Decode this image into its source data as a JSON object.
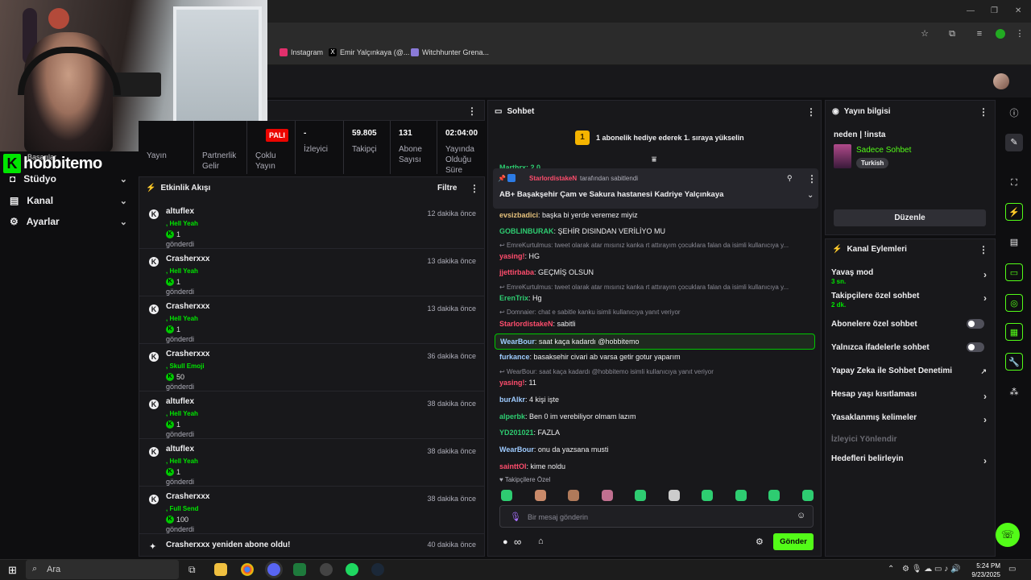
{
  "browser": {
    "bookmarks": [
      {
        "label": "Instagram",
        "icon": "instagram-icon",
        "color": "#e1306c"
      },
      {
        "label": "Emir Yalçınkaya (@...",
        "icon": "x-icon",
        "color": "#ffffff"
      },
      {
        "label": "Witchhunter Grena...",
        "icon": "game-icon",
        "color": "#8a7ad8"
      }
    ]
  },
  "nav": {
    "brand": "hobbitemo",
    "brand_letter": "K",
    "achievements": "Başarılar",
    "items": [
      {
        "label": "Stüdyo",
        "icon": "studio-icon"
      },
      {
        "label": "Kanal",
        "icon": "channel-icon"
      },
      {
        "label": "Ayarlar",
        "icon": "gear-icon"
      }
    ]
  },
  "stats": {
    "live_badge": "PALI",
    "viewers_value": "-",
    "viewers_label": "İzleyici",
    "followers_value": "59.805",
    "followers_label": "Takipçi",
    "subs_value": "131",
    "subs_label": "Abone Sayısı",
    "uptime_value": "02:04:00",
    "uptime_label": "Yayında Olduğu Süre",
    "stream_label": "Yayın",
    "partner_label": "Partnerlik Gelir",
    "multi_label": "Çoklu Yayın"
  },
  "activity": {
    "title": "Etkinlik Akışı",
    "filter": "Filtre",
    "events": [
      {
        "user": "altuflex",
        "item": "Hell Yeah",
        "count": "1",
        "sent": "gönderdi",
        "time": "12 dakika önce"
      },
      {
        "user": "Crasherxxx",
        "item": "Hell Yeah",
        "count": "1",
        "sent": "gönderdi",
        "time": "13 dakika önce"
      },
      {
        "user": "Crasherxxx",
        "item": "Hell Yeah",
        "count": "1",
        "sent": "gönderdi",
        "time": "13 dakika önce"
      },
      {
        "user": "Crasherxxx",
        "item": "Skull Emoji",
        "count": "50",
        "sent": "gönderdi",
        "time": "36 dakika önce"
      },
      {
        "user": "altuflex",
        "item": "Hell Yeah",
        "count": "1",
        "sent": "gönderdi",
        "time": "38 dakika önce"
      },
      {
        "user": "altuflex",
        "item": "Hell Yeah",
        "count": "1",
        "sent": "gönderdi",
        "time": "38 dakika önce"
      },
      {
        "user": "Crasherxxx",
        "item": "Full Send",
        "count": "100",
        "sent": "gönderdi",
        "time": "38 dakika önce"
      }
    ],
    "last_event": "Crasherxxx yeniden abone oldu!",
    "last_time": "40 dakika önce",
    "item_prefix": ","
  },
  "chat": {
    "title": "Sohbet",
    "gift_rank": "1",
    "gift_text": "1 abonelik hediye ederek 1. sıraya yükselin",
    "partial_top": "Marthrx: 2 0",
    "pinned_by_user": "StarlordistakeN",
    "pinned_by_suffix": " tarafından sabitlendi",
    "pinned_text": "AB+ Başakşehir Çam ve Sakura hastanesi Kadriye Yalçınkaya",
    "messages": [
      {
        "kind": "msg",
        "user": "evsizbadici",
        "color": "#e5c07b",
        "text": ": başka bi yerde veremez miyiz"
      },
      {
        "kind": "msg",
        "user": "GOBLINBURAK",
        "color": "#2ecc71",
        "text": ": ŞEHİR DISINDAN VERİLİYO MU"
      },
      {
        "kind": "reply",
        "text": "EmreKurtulmus: tweet olarak atar mısınız kanka rt attırayım çocuklara falan da isimli kullanıcıya y..."
      },
      {
        "kind": "msg",
        "user": "yasing!",
        "color": "#ff4d6d",
        "text": ": HG"
      },
      {
        "kind": "msg",
        "user": "jjettirbaba",
        "color": "#ff4d6d",
        "text": ": GEÇMİŞ OLSUN"
      },
      {
        "kind": "reply",
        "text": "EmreKurtulmus: tweet olarak atar mısınız kanka rt attırayım çocuklara falan da isimli kullanıcıya y..."
      },
      {
        "kind": "msg",
        "user": "ErenTrix",
        "color": "#2ecc71",
        "text": ": Hg"
      },
      {
        "kind": "reply",
        "text": "Domnaier: chat e sabitle kanku isimli kullanıcıya yanıt veriyor"
      },
      {
        "kind": "msg",
        "user": "StarlordistakeN",
        "color": "#ff4d6d",
        "text": ": sabitli"
      },
      {
        "kind": "hl",
        "user": "WearBour",
        "color": "#9ecbff",
        "text": ": saat kaça kadardı @hobbitemo"
      },
      {
        "kind": "msg",
        "user": "furkance",
        "color": "#9ecbff",
        "text": ": basaksehir civari ab varsa getir gotur yaparım"
      },
      {
        "kind": "reply",
        "text": "WearBour: saat kaça kadardı @hobbitemo isimli kullanıcıya yanıt veriyor"
      },
      {
        "kind": "msg",
        "user": "yasing!",
        "color": "#ff4d6d",
        "text": ": 11"
      },
      {
        "kind": "msg",
        "user": "burAlkr",
        "color": "#9ecbff",
        "text": ": 4 kişi işte"
      },
      {
        "kind": "msg",
        "user": "alperbk",
        "color": "#2ecc71",
        "text": ": Ben 0 im verebiliyor olmam lazım"
      },
      {
        "kind": "msg",
        "user": "YD201021",
        "color": "#2ecc71",
        "text": ": FAZLA"
      },
      {
        "kind": "msg",
        "user": "WearBour",
        "color": "#9ecbff",
        "text": ": onu da yazsana musti"
      },
      {
        "kind": "msg",
        "user": "sainttOl",
        "color": "#ff4d6d",
        "text": ": kime noldu"
      }
    ],
    "followers_only": "Takipçilere Özel",
    "input_placeholder": "Bir mesaj gönderin",
    "send_label": "Gönder",
    "infinity": "∞"
  },
  "stream_info": {
    "title": "Yayın bilgisi",
    "stream_title": "neden | !insta",
    "category": "Sadece Sohbet",
    "language": "Turkish",
    "edit_label": "Düzenle"
  },
  "channel_actions": {
    "title": "Kanal Eylemleri",
    "options": [
      {
        "label": "Yavaş mod",
        "sub": "3 sn.",
        "type": "arrow"
      },
      {
        "label": "Takipçilere özel sohbet",
        "sub": "2 dk.",
        "type": "arrow"
      },
      {
        "label": "Abonelere özel sohbet",
        "sub": "",
        "type": "toggle"
      },
      {
        "label": "Yalnızca ifadelerle sohbet",
        "sub": "",
        "type": "toggle"
      },
      {
        "label": "Yapay Zeka ile Sohbet Denetimi",
        "sub": "",
        "type": "external"
      },
      {
        "label": "Hesap yaşı kısıtlaması",
        "sub": "",
        "type": "arrow"
      },
      {
        "label": "Yasaklanmış kelimeler",
        "sub": "",
        "type": "arrow"
      },
      {
        "label": "İzleyici Yönlendir",
        "sub": "",
        "type": "disabled"
      },
      {
        "label": "Hedefleri belirleyin",
        "sub": "",
        "type": "arrow"
      }
    ]
  },
  "taskbar": {
    "search": "Ara",
    "time": "5:24 PM",
    "date": "9/23/2025"
  },
  "colors": {
    "accent": "#53fc18",
    "bg": "#0e0e10",
    "panel": "#18181b"
  }
}
